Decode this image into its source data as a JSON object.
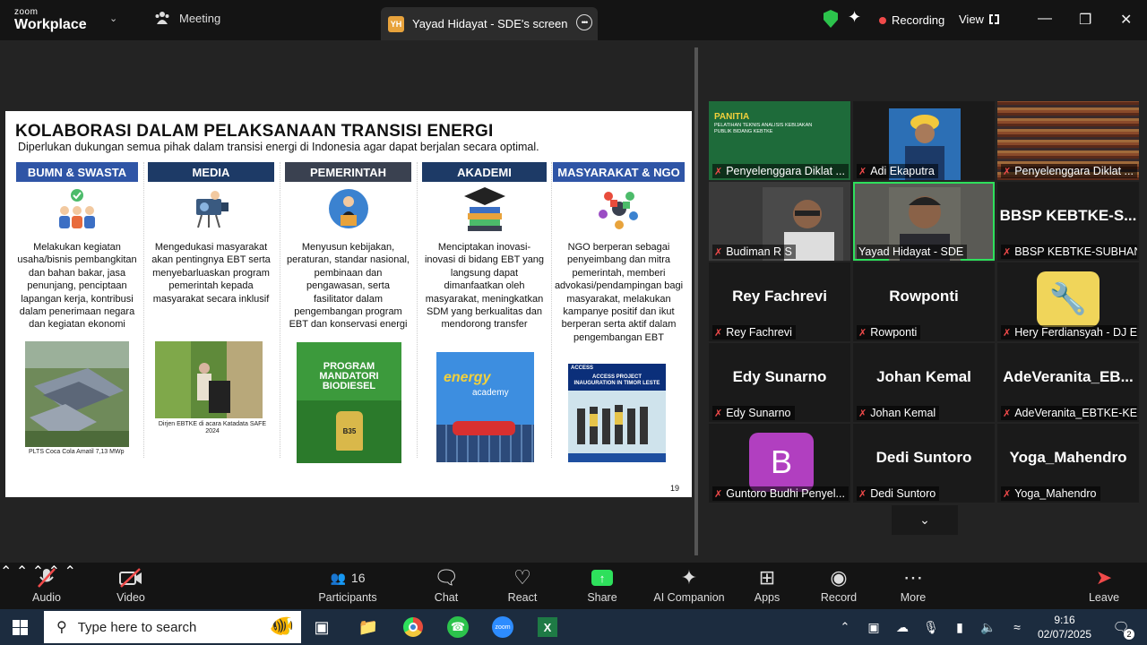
{
  "app": {
    "logo_line1": "zoom",
    "logo_line2": "Workplace",
    "meeting_label": "Meeting",
    "screen_tab_initials": "YH",
    "screen_tab_title": "Yayad Hidayat - SDE's screen",
    "recording_label": "Recording",
    "view_label": "View"
  },
  "slide": {
    "title": "KOLABORASI DALAM PELAKSANAAN TRANSISI ENERGI",
    "subtitle": "Diperlukan dukungan semua pihak dalam transisi energi di Indonesia agar dapat berjalan secara optimal.",
    "page_number": "19",
    "columns": [
      {
        "header": "BUMN & SWASTA",
        "color": "#2f55a6",
        "text": "Melakukan kegiatan usaha/bisnis pembangkitan dan bahan bakar, jasa penunjang, penciptaan lapangan kerja, kontribusi dalam penerimaan negara dan kegiatan ekonomi",
        "caption": "PLTS Coca Cola Amatil 7,13 MWp"
      },
      {
        "header": "MEDIA",
        "color": "#1d3a66",
        "text": "Mengedukasi masyarakat akan pentingnya EBT serta menyebarluaskan program pemerintah kepada masyarakat secara inklusif",
        "caption": "Dirjen EBTKE di acara Katadata SAFE 2024"
      },
      {
        "header": "PEMERINTAH",
        "color": "#3a4150",
        "text": "Menyusun kebijakan, peraturan, standar nasional, pembinaan dan pengawasan, serta fasilitator dalam pengembangan program EBT dan konservasi energi",
        "poster_line1": "PROGRAM",
        "poster_line2": "MANDATORI",
        "poster_line3": "BIODIESEL",
        "bottle_label": "B35"
      },
      {
        "header": "AKADEMI",
        "color": "#1d3a66",
        "text": "Menciptakan inovasi-inovasi di bidang EBT yang langsung dapat dimanfaatkan oleh masyarakat, meningkatkan SDM yang berkualitas dan mendorong transfer",
        "poster_line1": "energy",
        "poster_line2": "academy"
      },
      {
        "header": "MASYARAKAT & NGO",
        "color": "#2f55a6",
        "text": "NGO berperan sebagai penyeimbang dan mitra pemerintah, memberi advokasi/pendampingan bagi masyarakat, melakukan kampanye positif dan ikut berperan serta aktif dalam pengembangan EBT",
        "poster_brand": "ACCESS",
        "poster_line1": "ACCESS PROJECT",
        "poster_line2": "INAUGURATION IN TIMOR LESTE"
      }
    ]
  },
  "participants_tiles": [
    {
      "name": "Penyelenggara Diklat ...",
      "kind": "banner",
      "banner_title": "PANITIA",
      "banner_sub": "PELATIHAN TEKNIS ANALISIS KEBIJAKAN PUBLIK BIDANG KEBTKE"
    },
    {
      "name": "Adi Ekaputra",
      "kind": "video"
    },
    {
      "name": "Penyelenggara Diklat ...",
      "kind": "bookshelf"
    },
    {
      "name": "Budiman R S",
      "kind": "video"
    },
    {
      "name": "Yayad Hidayat - SDE",
      "kind": "video",
      "active": true
    },
    {
      "name": "BBSP KEBTKE-SUBHAN...",
      "kind": "text",
      "big": "BBSP  KEBTKE-S..."
    },
    {
      "name": "Rey Fachrevi",
      "kind": "text",
      "big": "Rey Fachrevi"
    },
    {
      "name": "Rowponti",
      "kind": "text",
      "big": "Rowponti"
    },
    {
      "name": "Hery Ferdiansyah - DJ EBT...",
      "kind": "tool"
    },
    {
      "name": "Edy Sunarno",
      "kind": "text",
      "big": "Edy Sunarno"
    },
    {
      "name": "Johan Kemal",
      "kind": "text",
      "big": "Johan Kemal"
    },
    {
      "name": "AdeVeranita_EBTKE-KE...",
      "kind": "text",
      "big": "AdeVeranita_EB..."
    },
    {
      "name": "Guntoro Budhi Penyel...",
      "kind": "letter",
      "big": "B"
    },
    {
      "name": "Dedi Suntoro",
      "kind": "text",
      "big": "Dedi Suntoro"
    },
    {
      "name": "Yoga_Mahendro",
      "kind": "text",
      "big": "Yoga_Mahendro"
    }
  ],
  "toolbar": {
    "audio": "Audio",
    "video": "Video",
    "participants": "Participants",
    "participants_count": "16",
    "chat": "Chat",
    "react": "React",
    "share": "Share",
    "companion": "AI Companion",
    "apps": "Apps",
    "record": "Record",
    "more": "More",
    "leave": "Leave"
  },
  "taskbar": {
    "search_placeholder": "Type here to search",
    "time": "9:16",
    "date": "02/07/2025",
    "notif_count": "2"
  }
}
